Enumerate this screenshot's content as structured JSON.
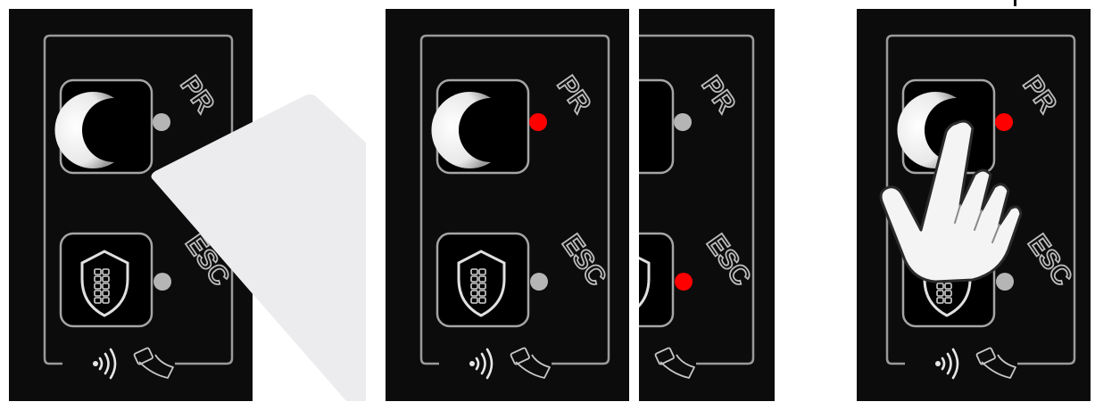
{
  "labels": {
    "pr": "PR",
    "esc": "ESC"
  },
  "colors": {
    "panel_bg": "#0c0c0c",
    "frame": "#9a9a9a",
    "led_off": "#b5b5b5",
    "led_on": "#ff0000",
    "card": "#ececef",
    "hand": "#f4f4f4"
  },
  "frames": [
    {
      "pr_led": "off",
      "esc_led": "off",
      "overlay": "contactless-card"
    },
    {
      "pr_led": "on",
      "esc_led": "off",
      "overlay": "none"
    },
    {
      "pr_led": "off",
      "esc_led": "on",
      "overlay": "none"
    },
    {
      "pr_led": "on",
      "esc_led": "off",
      "overlay": "pointing-hand"
    }
  ]
}
